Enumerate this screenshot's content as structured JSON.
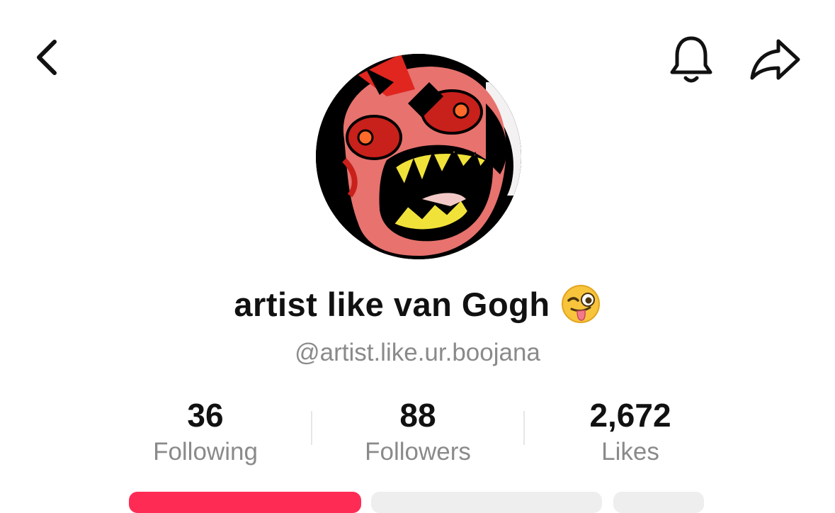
{
  "header": {
    "back_icon": "chevron-left-icon",
    "bell_icon": "bell-icon",
    "share_icon": "share-arrow-icon"
  },
  "profile": {
    "display_name": "artist like van Gogh",
    "name_emoji": "winking-face-with-tongue-emoji",
    "handle": "@artist.like.ur.boojana"
  },
  "stats": [
    {
      "value": "36",
      "label": "Following"
    },
    {
      "value": "88",
      "label": "Followers"
    },
    {
      "value": "2,672",
      "label": "Likes"
    }
  ],
  "colors": {
    "follow_button": "#fe2c55",
    "secondary_button": "#eeeeef",
    "muted_text": "#8a8a8a"
  }
}
